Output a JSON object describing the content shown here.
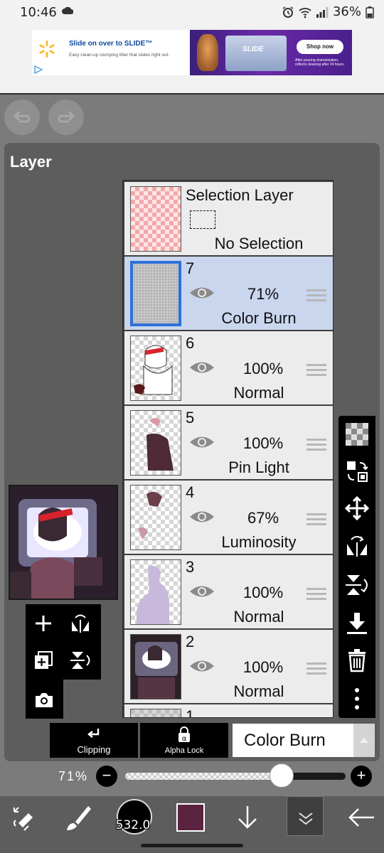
{
  "status_bar": {
    "time": "10:46",
    "battery": "36%"
  },
  "ad": {
    "headline": "Slide on over to SLIDE™",
    "subline": "Easy clean-up clumping litter that slides right out.",
    "brand": "SLIDE",
    "cta": "Shop now",
    "fine_print": "After pouring dramatization, reflects cleaning after 24 hours."
  },
  "panel": {
    "title": "Layer"
  },
  "selection_layer": {
    "title": "Selection Layer",
    "status": "No Selection"
  },
  "layers": [
    {
      "number": "7",
      "opacity": "71%",
      "blend": "Color Burn",
      "selected": true
    },
    {
      "number": "6",
      "opacity": "100%",
      "blend": "Normal",
      "selected": false
    },
    {
      "number": "5",
      "opacity": "100%",
      "blend": "Pin Light",
      "selected": false
    },
    {
      "number": "4",
      "opacity": "67%",
      "blend": "Luminosity",
      "selected": false
    },
    {
      "number": "3",
      "opacity": "100%",
      "blend": "Normal",
      "selected": false
    },
    {
      "number": "2",
      "opacity": "100%",
      "blend": "Normal",
      "selected": false
    },
    {
      "number": "1"
    }
  ],
  "controls": {
    "clipping_label": "Clipping",
    "alpha_lock_label": "Alpha Lock",
    "blend_mode": "Color Burn",
    "opacity_label": "71%",
    "opacity_value": 0.71,
    "minus": "−",
    "plus": "+"
  },
  "bottom_bar": {
    "brush_size": "532.0",
    "color": "#5b2340"
  },
  "colors": {
    "selected_row": "#c9d6ee",
    "selected_border": "#2e70d8",
    "panel_bg": "#5d5d5d"
  }
}
